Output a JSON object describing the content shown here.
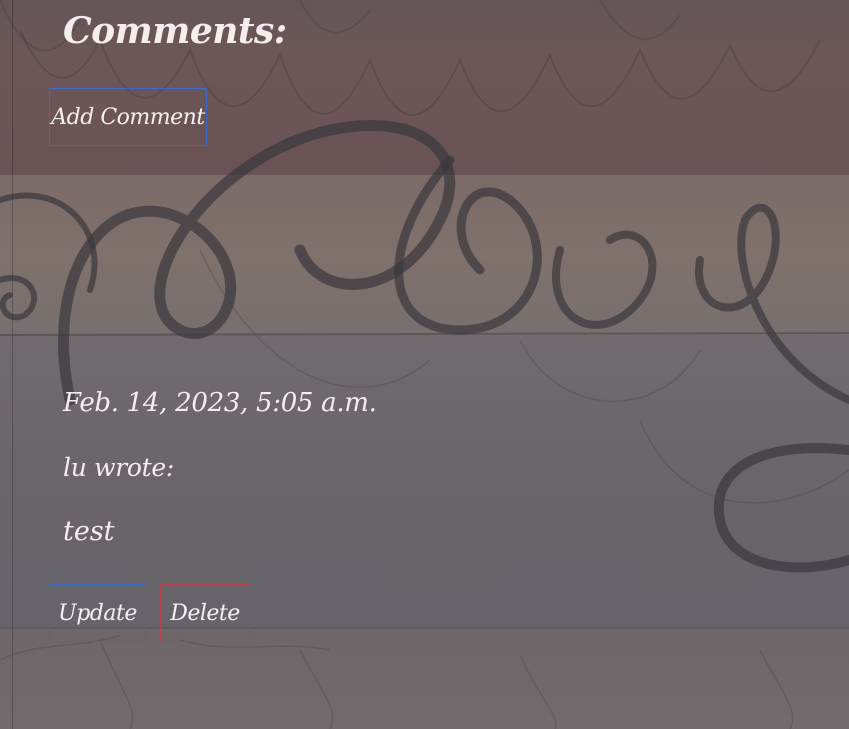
{
  "comments_section": {
    "heading": "Comments:",
    "add_button_label": "Add Comment"
  },
  "comments": [
    {
      "date": "Feb. 14, 2023, 5:05 a.m.",
      "author_line": "lu wrote:",
      "body": "test",
      "update_label": "Update",
      "delete_label": "Delete"
    }
  ],
  "colors": {
    "primary_outline": "#3f68c6",
    "danger_outline": "#b9424d",
    "text": "#f6f1f1"
  }
}
